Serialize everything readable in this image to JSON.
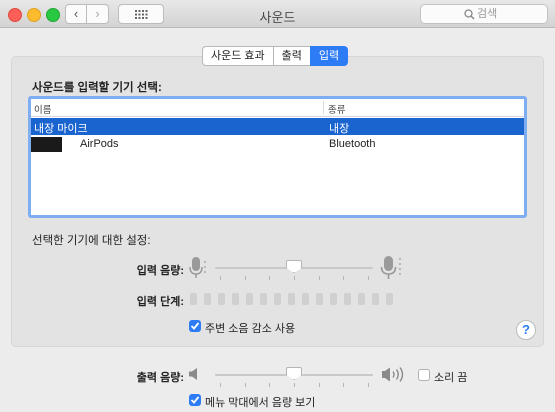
{
  "window": {
    "title": "사운드"
  },
  "toolbar": {
    "back_glyph": "‹",
    "forward_glyph": "›",
    "grid_icon": "grid-icon",
    "search_placeholder": "검색",
    "search_icon": "magnifier-icon"
  },
  "tabs": [
    {
      "label": "사운드 효과",
      "active": false
    },
    {
      "label": "출력",
      "active": false
    },
    {
      "label": "입력",
      "active": true
    }
  ],
  "input_section": {
    "title": "사운드를 입력할 기기 선택:",
    "columns": [
      "이름",
      "종류"
    ],
    "devices": [
      {
        "name": "내장 마이크",
        "type": "내장",
        "selected": true
      },
      {
        "name": "AirPods",
        "type": "Bluetooth",
        "selected": false,
        "name_partially_redacted": true
      }
    ]
  },
  "device_settings": {
    "title": "선택한 기기에 대한 설정:",
    "input_volume_label": "입력 음량:",
    "input_volume_level": 0.5,
    "input_level_label": "입력 단계:",
    "input_level_segments": 15,
    "noise_reduction_label": "주변 소음 감소 사용",
    "noise_reduction_checked": true,
    "help_glyph": "?"
  },
  "output": {
    "volume_label": "출력 음량:",
    "volume_level": 0.5,
    "mute_label": "소리 끔",
    "mute_checked": false,
    "show_in_menubar_label": "메뉴 막대에서 음량 보기",
    "show_in_menubar_checked": true
  },
  "colors": {
    "accent": "#2e7bf6",
    "selection": "#1a64d0"
  }
}
